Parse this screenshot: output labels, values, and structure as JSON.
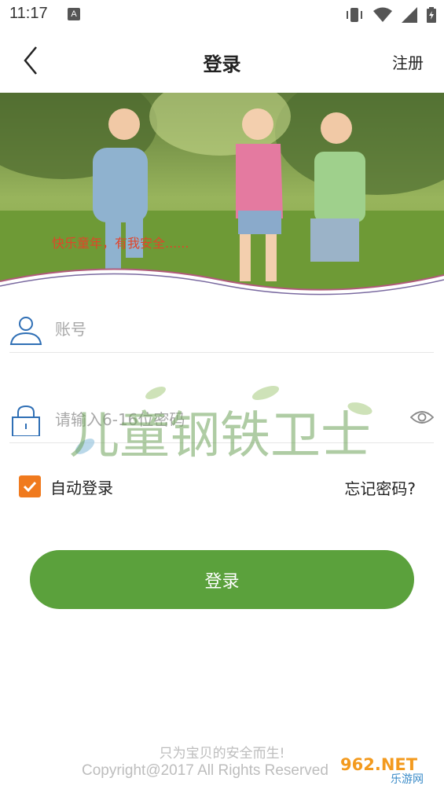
{
  "status_bar": {
    "time": "11:17",
    "notification_badge": "A"
  },
  "header": {
    "title": "登录",
    "register_label": "注册",
    "back_icon": "chevron-left-icon"
  },
  "banner": {
    "caption": "快乐童年，有我安全......"
  },
  "form": {
    "account": {
      "placeholder": "账号",
      "value": "",
      "icon": "user-icon"
    },
    "password": {
      "placeholder": "请输入6-16位密码",
      "value": "",
      "icon": "lock-icon",
      "toggle_icon": "eye-icon"
    },
    "auto_login": {
      "label": "自动登录",
      "checked": true
    },
    "forgot_label": "忘记密码?",
    "login_button": "登录"
  },
  "watermark": {
    "text": "儿童钢铁卫士"
  },
  "footer": {
    "slogan": "只为宝贝的安全而生!",
    "copyright": "Copyright@2017 All Rights Reserved"
  },
  "corner_badge": {
    "primary": "962.NET",
    "secondary": "乐游网"
  },
  "colors": {
    "accent_green": "#5ba13c",
    "checkbox_orange": "#f07a1e",
    "icon_blue": "#2f6fb5",
    "banner_caption": "#e0452a"
  }
}
